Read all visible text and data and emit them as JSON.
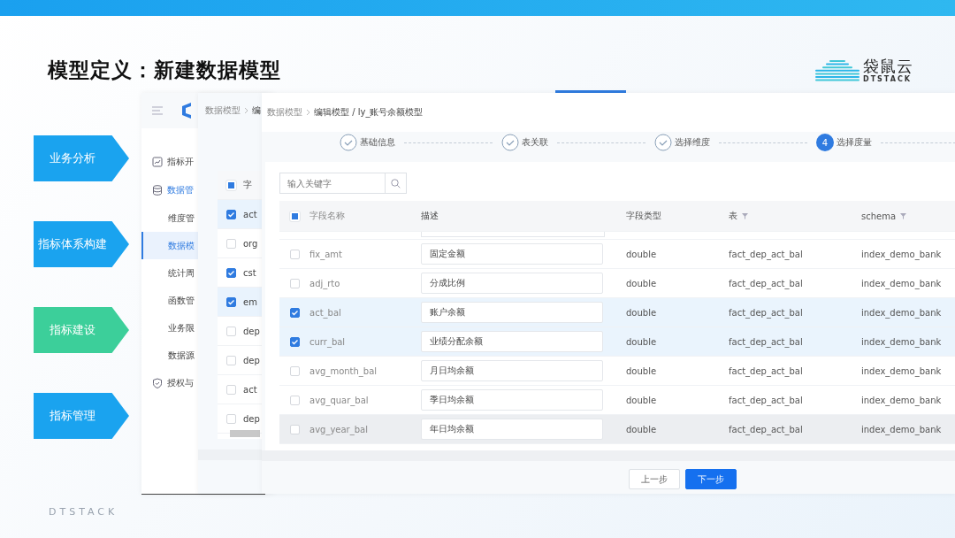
{
  "slide": {
    "title": "模型定义：新建数据模型",
    "footer": "DTSTACK"
  },
  "logo": {
    "name": "袋鼠云",
    "sub": "DTSTACK"
  },
  "process": [
    {
      "label": "业务分析",
      "color": "#1aa3ef"
    },
    {
      "label": "指标体系构建",
      "color": "#1aa3ef"
    },
    {
      "label": "指标建设",
      "color": "#3ccf9a"
    },
    {
      "label": "指标管理",
      "color": "#1aa3ef"
    }
  ],
  "back_window": {
    "nav": [
      {
        "label": "指标开",
        "active": false
      },
      {
        "label": "数据管",
        "active": true,
        "children": [
          {
            "label": "维度管",
            "selected": false
          },
          {
            "label": "数据模",
            "selected": true
          },
          {
            "label": "统计周",
            "selected": false
          },
          {
            "label": "函数管",
            "selected": false
          },
          {
            "label": "业务限",
            "selected": false
          },
          {
            "label": "数据源",
            "selected": false
          }
        ]
      },
      {
        "label": "授权与",
        "active": false
      }
    ]
  },
  "middle_window": {
    "breadcrumb": [
      "数据模型",
      "编"
    ],
    "table": {
      "header": {
        "label": "字",
        "indeterminate": true
      },
      "rows": [
        {
          "name": "act",
          "checked": true,
          "highlighted": true
        },
        {
          "name": "org",
          "checked": false,
          "highlighted": false
        },
        {
          "name": "cst",
          "checked": true,
          "highlighted": false
        },
        {
          "name": "em",
          "checked": true,
          "highlighted": true
        },
        {
          "name": "dep",
          "checked": false,
          "highlighted": false
        },
        {
          "name": "dep",
          "checked": false,
          "highlighted": false
        },
        {
          "name": "act",
          "checked": false,
          "highlighted": false
        },
        {
          "name": "dep",
          "checked": false,
          "highlighted": false
        }
      ]
    }
  },
  "front_window": {
    "breadcrumb": [
      "数据模型",
      "编辑模型 / ly_账号余额模型"
    ],
    "steps": [
      {
        "label": "基础信息",
        "completed": true
      },
      {
        "label": "表关联",
        "completed": true
      },
      {
        "label": "选择维度",
        "completed": true
      },
      {
        "label": "选择度量",
        "completed": false,
        "number": "4"
      }
    ],
    "search": {
      "placeholder": "输入关键字"
    },
    "table": {
      "select_all": {
        "indeterminate": true
      },
      "columns": [
        {
          "label": "字段名称",
          "filter": false
        },
        {
          "label": "描述",
          "filter": false
        },
        {
          "label": "字段类型",
          "filter": false
        },
        {
          "label": "表",
          "filter": true
        },
        {
          "label": "schema",
          "filter": true
        }
      ],
      "rows": [
        {
          "name": "fix_amt",
          "description": "固定金额",
          "type": "double",
          "table": "fact_dep_act_bal",
          "schema": "index_demo_bank",
          "checked": false,
          "hover": false
        },
        {
          "name": "adj_rto",
          "description": "分成比例",
          "type": "double",
          "table": "fact_dep_act_bal",
          "schema": "index_demo_bank",
          "checked": false,
          "hover": false
        },
        {
          "name": "act_bal",
          "description": "账户余额",
          "type": "double",
          "table": "fact_dep_act_bal",
          "schema": "index_demo_bank",
          "checked": true,
          "hover": false
        },
        {
          "name": "curr_bal",
          "description": "业绩分配余额",
          "type": "double",
          "table": "fact_dep_act_bal",
          "schema": "index_demo_bank",
          "checked": true,
          "hover": false
        },
        {
          "name": "avg_month_bal",
          "description": "月日均余额",
          "type": "double",
          "table": "fact_dep_act_bal",
          "schema": "index_demo_bank",
          "checked": false,
          "hover": false
        },
        {
          "name": "avg_quar_bal",
          "description": "季日均余额",
          "type": "double",
          "table": "fact_dep_act_bal",
          "schema": "index_demo_bank",
          "checked": false,
          "hover": false
        },
        {
          "name": "avg_year_bal",
          "description": "年日均余额",
          "type": "double",
          "table": "fact_dep_act_bal",
          "schema": "index_demo_bank",
          "checked": false,
          "hover": true
        }
      ]
    },
    "buttons": [
      {
        "label": "上一步",
        "primary": false
      },
      {
        "label": "下一步",
        "primary": true
      }
    ]
  }
}
